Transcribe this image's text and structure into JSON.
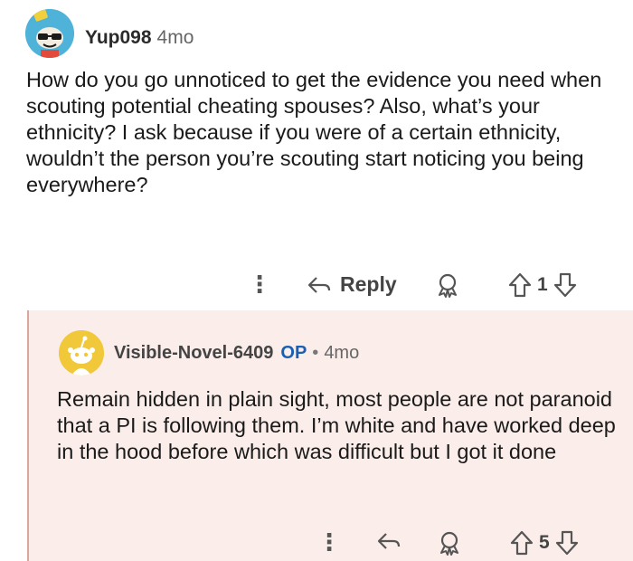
{
  "comment1": {
    "username": "Yup098",
    "age": "4mo",
    "body": "How do you go unnoticed to get the evidence you need when scouting potential cheating spouses? Also, what’s your ethnicity? I ask because if you were of a certain ethnicity, wouldn’t the person you’re scouting start noticing you being everywhere?",
    "reply_label": "Reply",
    "vote_count": "1",
    "icons": [
      "more-options-icon",
      "reply-icon",
      "award-icon",
      "upvote-icon",
      "downvote-icon"
    ]
  },
  "comment2": {
    "username": "Visible-Novel-6409",
    "op_badge": "OP",
    "separator": "•",
    "age": "4mo",
    "body": "Remain hidden in plain sight, most people are not paranoid that a PI is following them. I’m white and have worked deep in the hood before which was difficult but I got it done",
    "vote_count": "5",
    "icons": [
      "more-options-icon",
      "reply-icon",
      "award-icon",
      "upvote-icon",
      "downvote-icon"
    ]
  },
  "colors": {
    "reply_background": "#fbeeea",
    "thread_line": "#d9a79b",
    "op_badge": "#1a5fb4",
    "avatar1_bg": "#4fb3d9",
    "avatar2_bg": "#f0c83a"
  }
}
